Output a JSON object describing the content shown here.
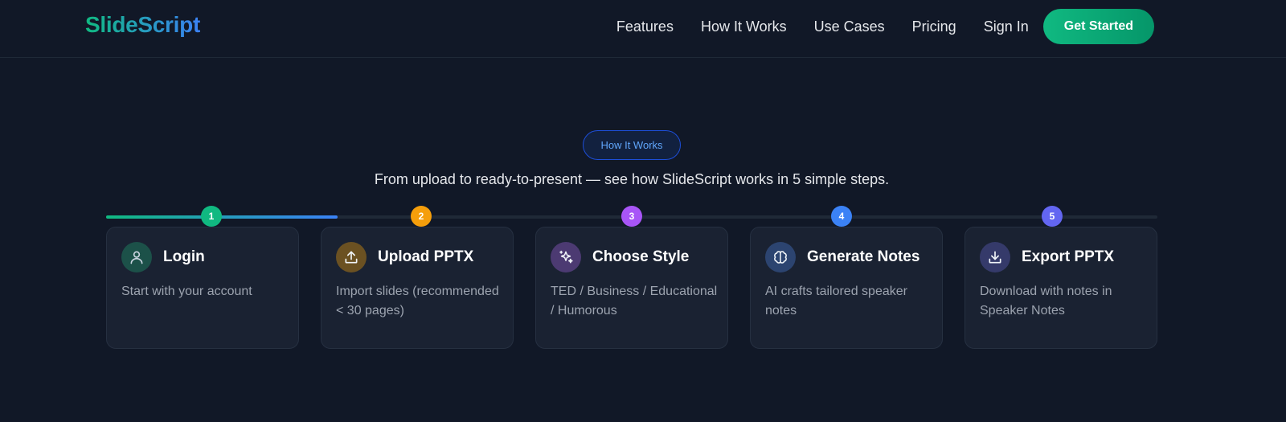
{
  "header": {
    "logo": "SlideScript",
    "nav": [
      "Features",
      "How It Works",
      "Use Cases",
      "Pricing"
    ],
    "sign_in": "Sign In",
    "get_started": "Get Started"
  },
  "section": {
    "badge": "How It Works",
    "subtitle": "From upload to ready-to-present — see how SlideScript works in 5 simple steps."
  },
  "progress": {
    "fraction": 0.22
  },
  "colors": {
    "accent_green": "#10b981",
    "accent_blue": "#3b82f6",
    "background": "#111827"
  },
  "steps": [
    {
      "number": "1",
      "title": "Login",
      "description": "Start with your account",
      "icon": "user-icon",
      "color": "#10b981",
      "icon_bg": "#1c5149",
      "icon_fg": "#cbd5e1"
    },
    {
      "number": "2",
      "title": "Upload PPTX",
      "description": "Import slides (recommended < 30 pages)",
      "icon": "upload-icon",
      "color": "#f59e0b",
      "icon_bg": "#6b5122",
      "icon_fg": "#f1f5f9"
    },
    {
      "number": "3",
      "title": "Choose Style",
      "description": "TED / Business / Educational / Humorous",
      "icon": "sparkles-icon",
      "color": "#a855f7",
      "icon_bg": "#4c3a72",
      "icon_fg": "#f1f5f9"
    },
    {
      "number": "4",
      "title": "Generate Notes",
      "description": "AI crafts tailored speaker notes",
      "icon": "brain-icon",
      "color": "#3b82f6",
      "icon_bg": "#2c4470",
      "icon_fg": "#f1f5f9"
    },
    {
      "number": "5",
      "title": "Export PPTX",
      "description": "Download with notes in Speaker Notes",
      "icon": "download-icon",
      "color": "#6366f1",
      "icon_bg": "#353a6a",
      "icon_fg": "#f1f5f9"
    }
  ]
}
